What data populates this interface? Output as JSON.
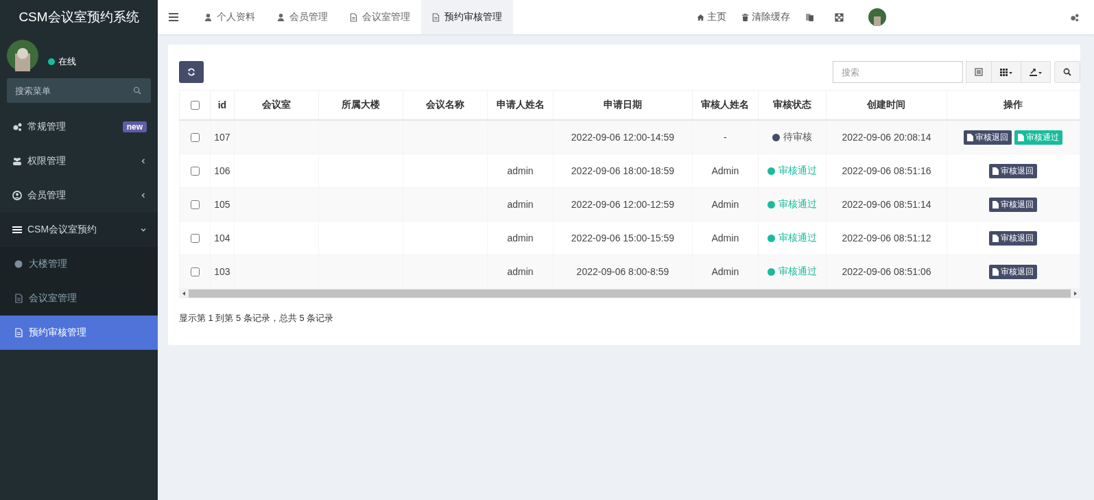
{
  "sidebar": {
    "title": "CSM会议室预约系统",
    "user": {
      "status": "在线"
    },
    "search": {
      "placeholder": "搜索菜单"
    },
    "menu": [
      {
        "label": "常规管理",
        "badge": "new"
      },
      {
        "label": "权限管理",
        "expanded": false
      },
      {
        "label": "会员管理",
        "expanded": false
      },
      {
        "label": "CSM会议室预约",
        "expanded": true,
        "children": [
          {
            "label": "大楼管理",
            "selected": false
          },
          {
            "label": "会议室管理",
            "selected": false
          },
          {
            "label": "预约审核管理",
            "selected": true
          }
        ]
      }
    ]
  },
  "topbar": {
    "tabs": [
      {
        "label": "个人资料",
        "selected": false
      },
      {
        "label": "会员管理",
        "selected": false
      },
      {
        "label": "会议室管理",
        "selected": false
      },
      {
        "label": "预约审核管理",
        "selected": true
      }
    ],
    "actions": [
      {
        "label": "主页"
      },
      {
        "label": "清除缓存"
      }
    ]
  },
  "toolbar": {
    "search": {
      "placeholder": "搜索"
    }
  },
  "table": {
    "all_checked": false,
    "columns": [
      "id",
      "会议室",
      "所属大楼",
      "会议名称",
      "申请人姓名",
      "申请日期",
      "审核人姓名",
      "审核状态",
      "创建时间",
      "操作"
    ],
    "rows": [
      {
        "checked": false,
        "id": "107",
        "date": "2022-09-06 12:00-14:59",
        "reviewer": "-",
        "status": {
          "kind": "pending",
          "text": "待审核"
        },
        "created": "2022-09-06 20:08:14",
        "actions": [
          {
            "kind": "reject",
            "label": "审核退回"
          },
          {
            "kind": "approve",
            "label": "审核通过"
          }
        ]
      },
      {
        "checked": false,
        "id": "106",
        "applicant": "admin",
        "date": "2022-09-06 18:00-18:59",
        "reviewer": "Admin",
        "status": {
          "kind": "approved",
          "text": "审核通过"
        },
        "created": "2022-09-06 08:51:16",
        "actions": [
          {
            "kind": "reject",
            "label": "审核退回"
          }
        ]
      },
      {
        "checked": false,
        "id": "105",
        "applicant": "admin",
        "date": "2022-09-06 12:00-12:59",
        "reviewer": "Admin",
        "status": {
          "kind": "approved",
          "text": "审核通过"
        },
        "created": "2022-09-06 08:51:14",
        "actions": [
          {
            "kind": "reject",
            "label": "审核退回"
          }
        ]
      },
      {
        "checked": false,
        "id": "104",
        "applicant": "admin",
        "date": "2022-09-06 15:00-15:59",
        "reviewer": "Admin",
        "status": {
          "kind": "approved",
          "text": "审核通过"
        },
        "created": "2022-09-06 08:51:12",
        "actions": [
          {
            "kind": "reject",
            "label": "审核退回"
          }
        ]
      },
      {
        "checked": false,
        "id": "103",
        "applicant": "admin",
        "date": "2022-09-06 8:00-8:59",
        "reviewer": "Admin",
        "status": {
          "kind": "approved",
          "text": "审核通过"
        },
        "created": "2022-09-06 08:51:06",
        "actions": [
          {
            "kind": "reject",
            "label": "审核退回"
          }
        ]
      }
    ]
  },
  "footer": "显示第 1 到第 5 条记录，总共 5 条记录"
}
